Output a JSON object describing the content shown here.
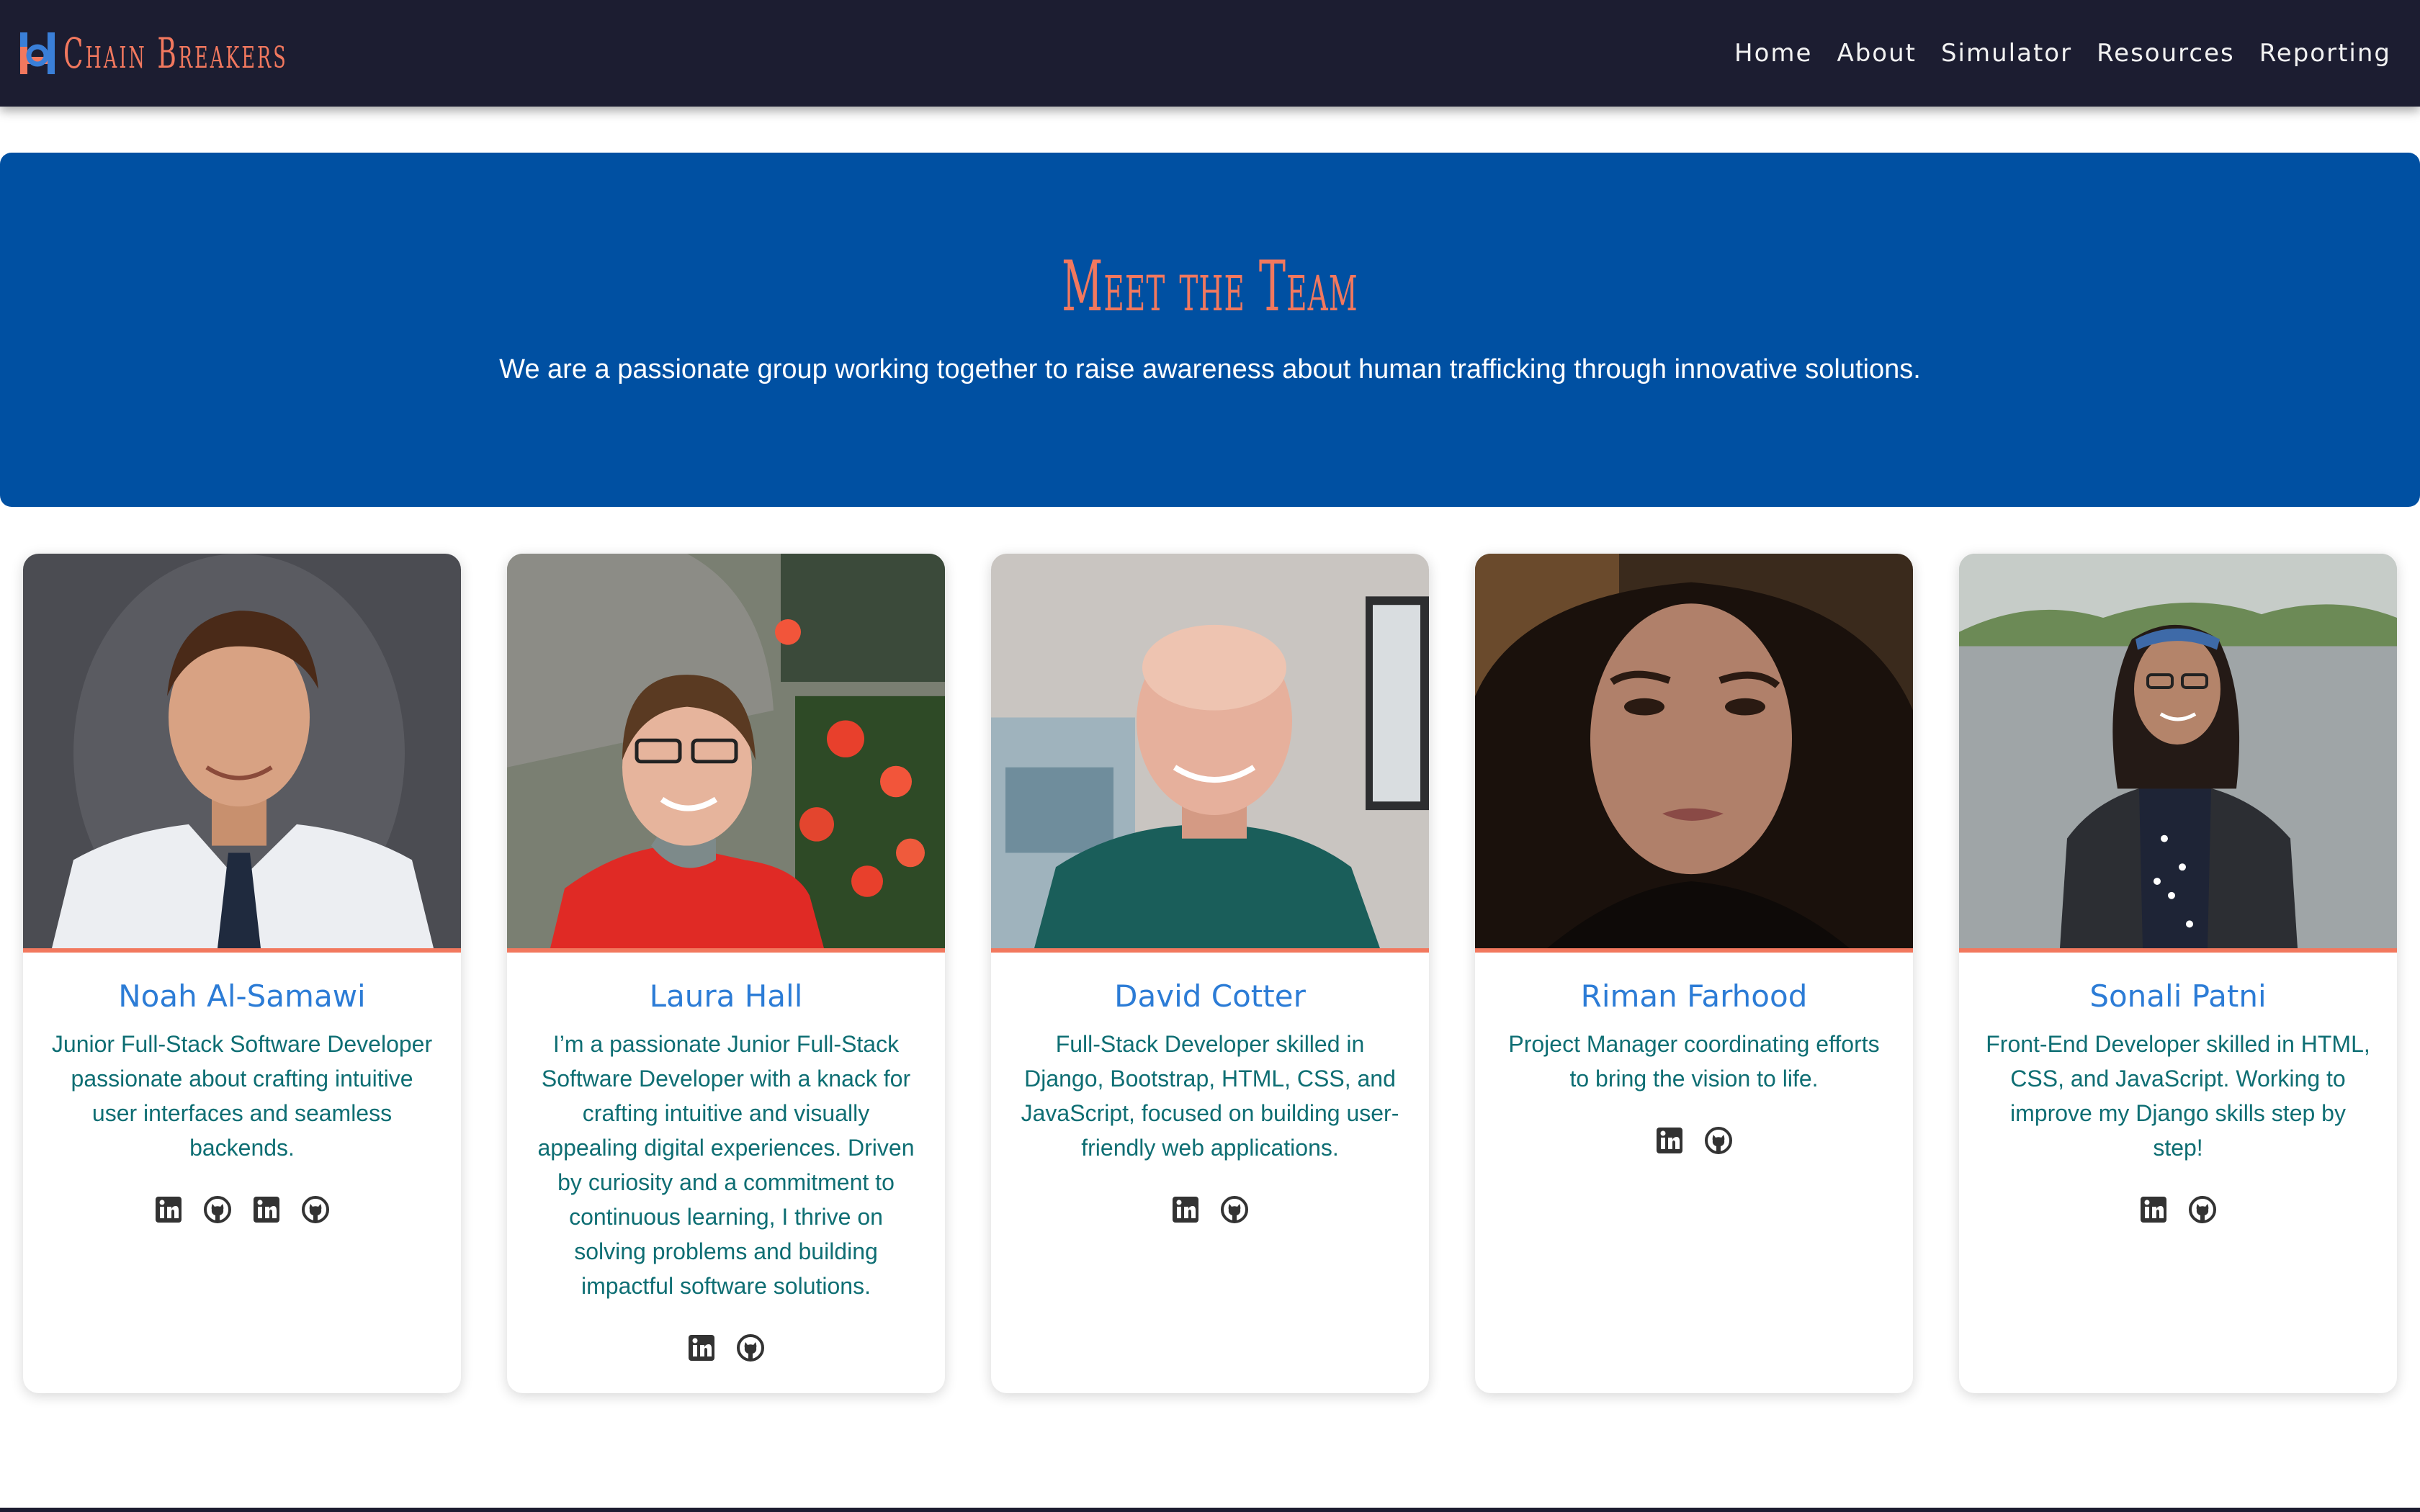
{
  "brand": {
    "name": "Chain Breakers",
    "logo_icon": "chain-breakers-logo-icon"
  },
  "nav": {
    "links": [
      {
        "label": "Home"
      },
      {
        "label": "About"
      },
      {
        "label": "Simulator"
      },
      {
        "label": "Resources"
      },
      {
        "label": "Reporting"
      }
    ]
  },
  "hero": {
    "title": "Meet the Team",
    "subtitle": "We are a passionate group working together to raise awareness about human trafficking through innovative solutions."
  },
  "team": [
    {
      "name": "Noah Al-Samawi",
      "bio": "Junior Full-Stack Software Developer passionate about crafting intuitive user interfaces and seamless backends.",
      "socials": [
        "linkedin-icon",
        "github-icon",
        "linkedin-icon",
        "github-icon"
      ]
    },
    {
      "name": "Laura Hall",
      "bio": "I’m a passionate Junior Full-Stack Software Developer with a knack for crafting intuitive and visually appealing digital experiences. Driven by curiosity and a commitment to continuous learning, I thrive on solving problems and building impactful software solutions.",
      "socials": [
        "linkedin-icon",
        "github-icon"
      ]
    },
    {
      "name": "David Cotter",
      "bio": "Full-Stack Developer skilled in Django, Bootstrap, HTML, CSS, and JavaScript, focused on building user-friendly web applications.",
      "socials": [
        "linkedin-icon",
        "github-icon"
      ]
    },
    {
      "name": "Riman Farhood",
      "bio": "Project Manager coordinating efforts to bring the vision to life.",
      "socials": [
        "linkedin-icon",
        "github-icon"
      ]
    },
    {
      "name": "Sonali Patni",
      "bio": "Front-End Developer skilled in HTML, CSS, and JavaScript. Working to improve my Django skills step by step!",
      "socials": [
        "linkedin-icon",
        "github-icon"
      ]
    }
  ],
  "colors": {
    "navbar_bg": "#1c1d31",
    "brand_accent": "#f2785e",
    "hero_bg": "#0050a2",
    "name_blue": "#2c7cd6",
    "bio_teal": "#0e6e73"
  }
}
